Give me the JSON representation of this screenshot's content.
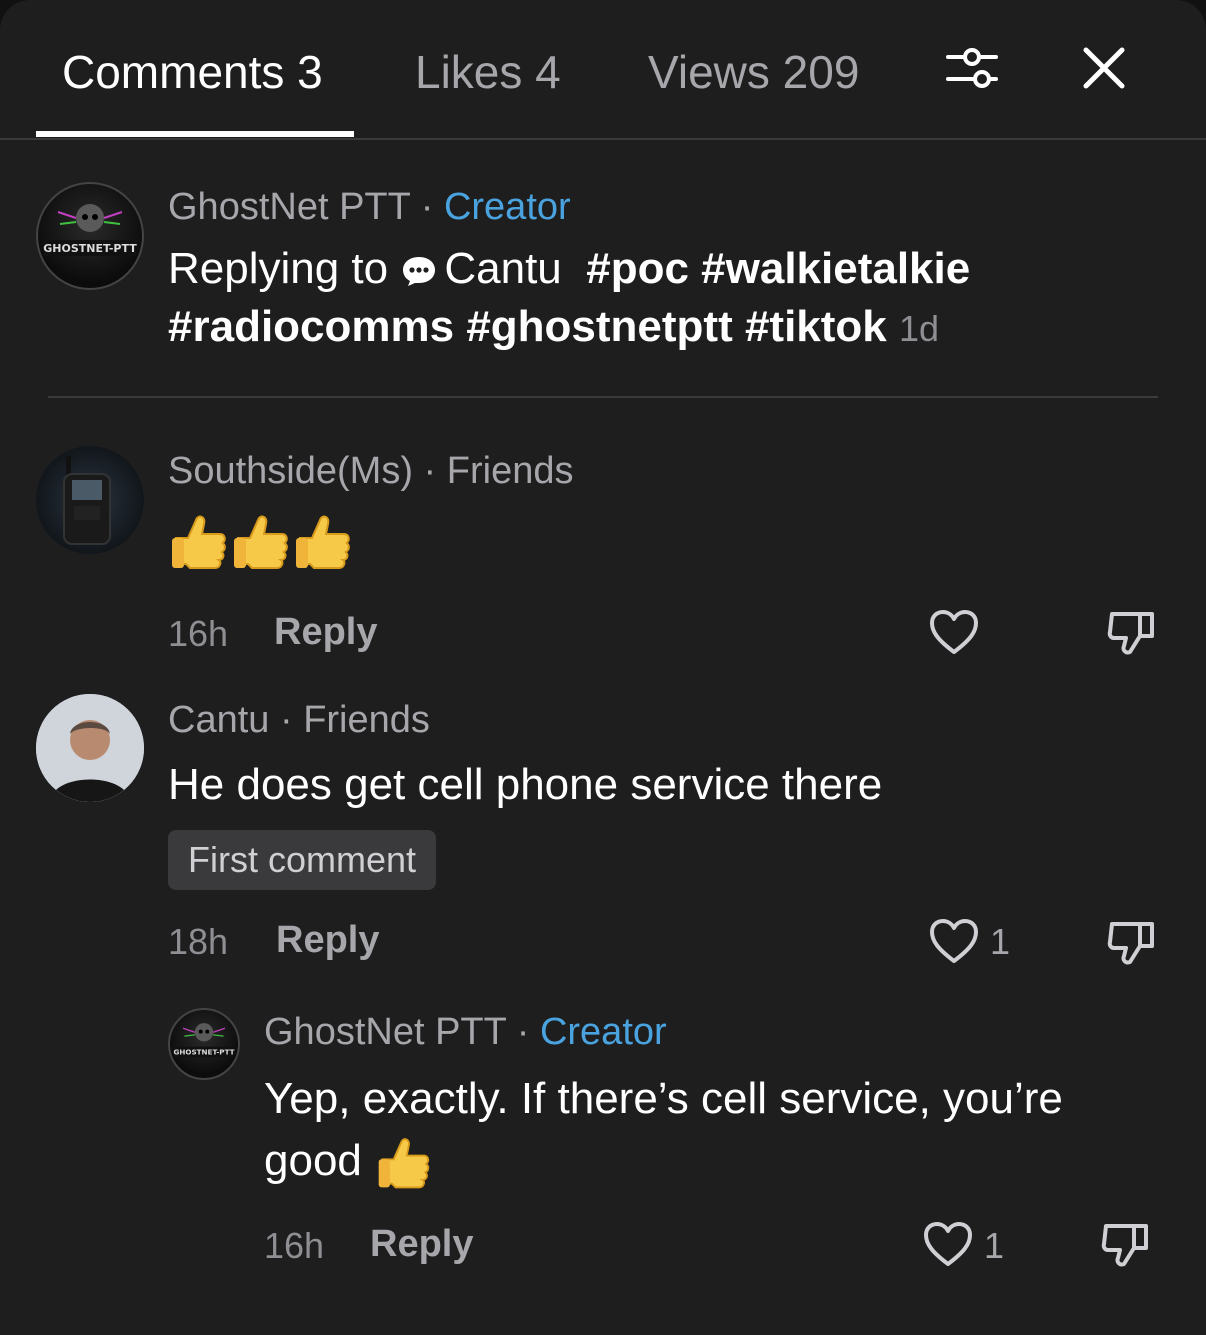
{
  "tabs": {
    "comments": "Comments 3",
    "likes": "Likes 4",
    "views": "Views 209"
  },
  "comments": [
    {
      "author": "GhostNet PTT",
      "sep": " · ",
      "role": "Creator",
      "avatar_text": "GHOSTNET-PTT",
      "reply_prefix": "Replying to ",
      "reply_target": "Cantu",
      "hashtags_line1": "#poc #walkietalkie",
      "hashtags_line2": "#radiocomms #ghostnetptt #tiktok",
      "time": "1d"
    },
    {
      "author": "Southside(Ms)",
      "sep": " · ",
      "role": "Friends",
      "text_emoji": "thumbs-up x3",
      "time": "16h",
      "reply": "Reply"
    },
    {
      "author": "Cantu",
      "sep": " · ",
      "role": "Friends",
      "text": "He does get cell phone service there",
      "badge": "First comment",
      "time": "18h",
      "reply": "Reply",
      "likes": "1"
    },
    {
      "author": "GhostNet PTT",
      "sep": " · ",
      "role": "Creator",
      "avatar_text": "GHOSTNET-PTT",
      "text_line1": "Yep, exactly. If there’s cell service, you’re",
      "text_line2": "good",
      "time": "16h",
      "reply": "Reply",
      "likes": "1"
    }
  ],
  "colors": {
    "background": "#1e1e1f",
    "creator": "#4aa3df",
    "muted": "#a6a6ab"
  },
  "icons": [
    "filter-icon",
    "close-icon",
    "heart-icon",
    "dislike-icon",
    "chat-bubble-icon",
    "thumbs-up-emoji"
  ]
}
